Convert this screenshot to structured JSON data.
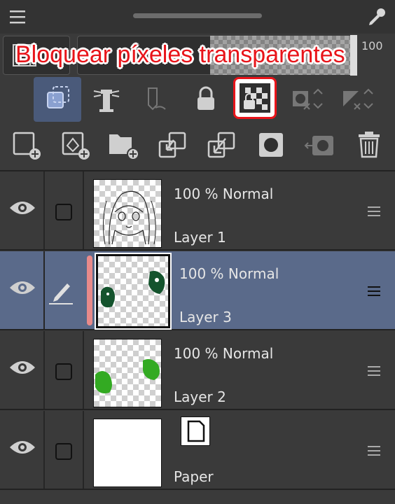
{
  "callout": {
    "text": "Bloquear píxeles transparentes",
    "color": "#e8141a"
  },
  "opacity_control": {
    "value_text": "100"
  },
  "toggles": [
    {
      "name": "clip-to-layer-below-icon",
      "active": true
    },
    {
      "name": "reference-layer-icon",
      "active": false
    },
    {
      "name": "draft-layer-icon",
      "active": false
    },
    {
      "name": "lock-layer-icon",
      "active": false
    },
    {
      "name": "lock-transparent-pixels-icon",
      "active": false,
      "highlighted": true
    },
    {
      "name": "mask-options-icon",
      "active": false
    },
    {
      "name": "ruler-options-icon",
      "active": false
    }
  ],
  "actions": [
    "new-raster-layer-icon",
    "new-vector-layer-icon",
    "new-folder-icon",
    "transfer-to-lower-layer-icon",
    "combine-to-lower-layer-icon",
    "create-layer-mask-icon",
    "apply-mask-icon",
    "delete-layer-icon"
  ],
  "layers": [
    {
      "opacity": "100 %",
      "mode": "Normal",
      "name": "Layer 1",
      "selected": false,
      "thumb": "sketch"
    },
    {
      "opacity": "100 %",
      "mode": "Normal",
      "name": "Layer 3",
      "selected": true,
      "thumb": "dark-green-blobs"
    },
    {
      "opacity": "100 %",
      "mode": "Normal",
      "name": "Layer 2",
      "selected": false,
      "thumb": "green-blobs"
    },
    {
      "opacity": "",
      "mode": "",
      "name": "Paper",
      "selected": false,
      "thumb": "white"
    }
  ],
  "colors": {
    "selected_row": "#5a6a8a",
    "panel_bg": "#3a3a3a",
    "green_light": "#33aa22",
    "green_dark": "#14532d"
  }
}
